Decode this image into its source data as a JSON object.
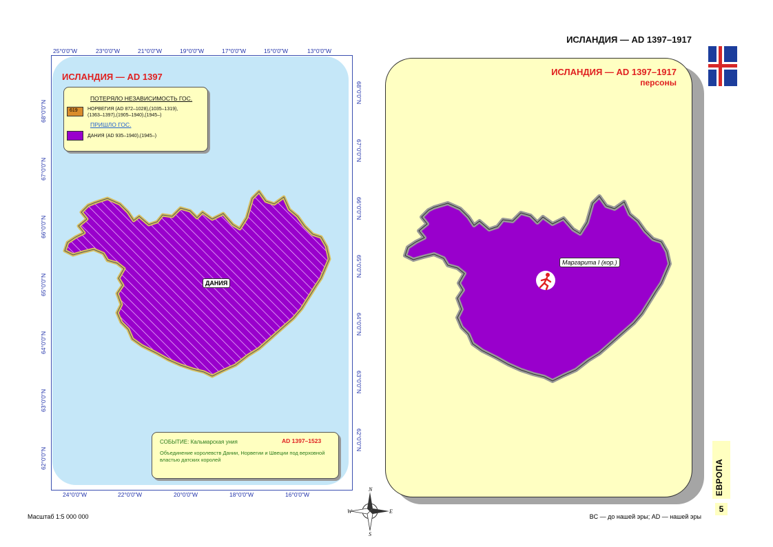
{
  "header": {
    "title": "ИСЛАНДИЯ — AD 1397–1917"
  },
  "left_map": {
    "title": "ИСЛАНДИЯ — AD 1397",
    "top_ticks": [
      "25°0'0\"W",
      "23°0'0\"W",
      "21°0'0\"W",
      "19°0'0\"W",
      "17°0'0\"W",
      "15°0'0\"W",
      "13°0'0\"W"
    ],
    "bottom_ticks": [
      "24°0'0\"W",
      "22°0'0\"W",
      "20°0'0\"W",
      "18°0'0\"W",
      "16°0'0\"W"
    ],
    "left_ticks": [
      "68°0'0\"N",
      "67°0'0\"N",
      "66°0'0\"N",
      "65°0'0\"N",
      "64°0'0\"N",
      "63°0'0\"N",
      "62°0'0\"N"
    ],
    "right_ticks": [
      "68°0'0\"N",
      "67°0'0\"N",
      "66°0'0\"N",
      "65°0'0\"N",
      "64°0'0\"N",
      "63°0'0\"N",
      "62°0'0\"N"
    ],
    "legend": {
      "lost_header": "ПОТЕРЯЛО НЕЗАВИСИМОСТЬ ГОС.",
      "norway_code": "619",
      "norway_text_1": "НОРВЕГИЯ (AD 872–1028),(1035–1319),",
      "norway_text_2": "(1363–1397),(1905–1940),(1945–)",
      "came_header": "ПРИШЛО ГОС.",
      "denmark_text": "ДАНИЯ (AD 935–1940),(1945–)",
      "norway_color": "#d98c2b",
      "denmark_color": "#9900cc"
    },
    "region_label": "ДАНИЯ",
    "event": {
      "label": "СОБЫТИЕ: Кальмарская уния",
      "years": "AD 1397–1523",
      "description": "Объединение королевств Дании, Норвегии и Швеции под верховной властью датских королей"
    }
  },
  "right_map": {
    "title": "ИСЛАНДИЯ — AD 1397–1917",
    "subtitle": "персоны",
    "person_label": "Маргарита I (кор.)",
    "person_icon": "running-person-icon"
  },
  "footer": {
    "scale": "Масштаб 1:5 000 000",
    "era_note": "BC — до нашей эры; AD — нашей эры",
    "section": "ЕВРОПА",
    "page": "5"
  },
  "colors": {
    "sea": "#c5e7f8",
    "land": "#9900cc",
    "panel": "#ffffc2",
    "accent": "#e02020"
  }
}
